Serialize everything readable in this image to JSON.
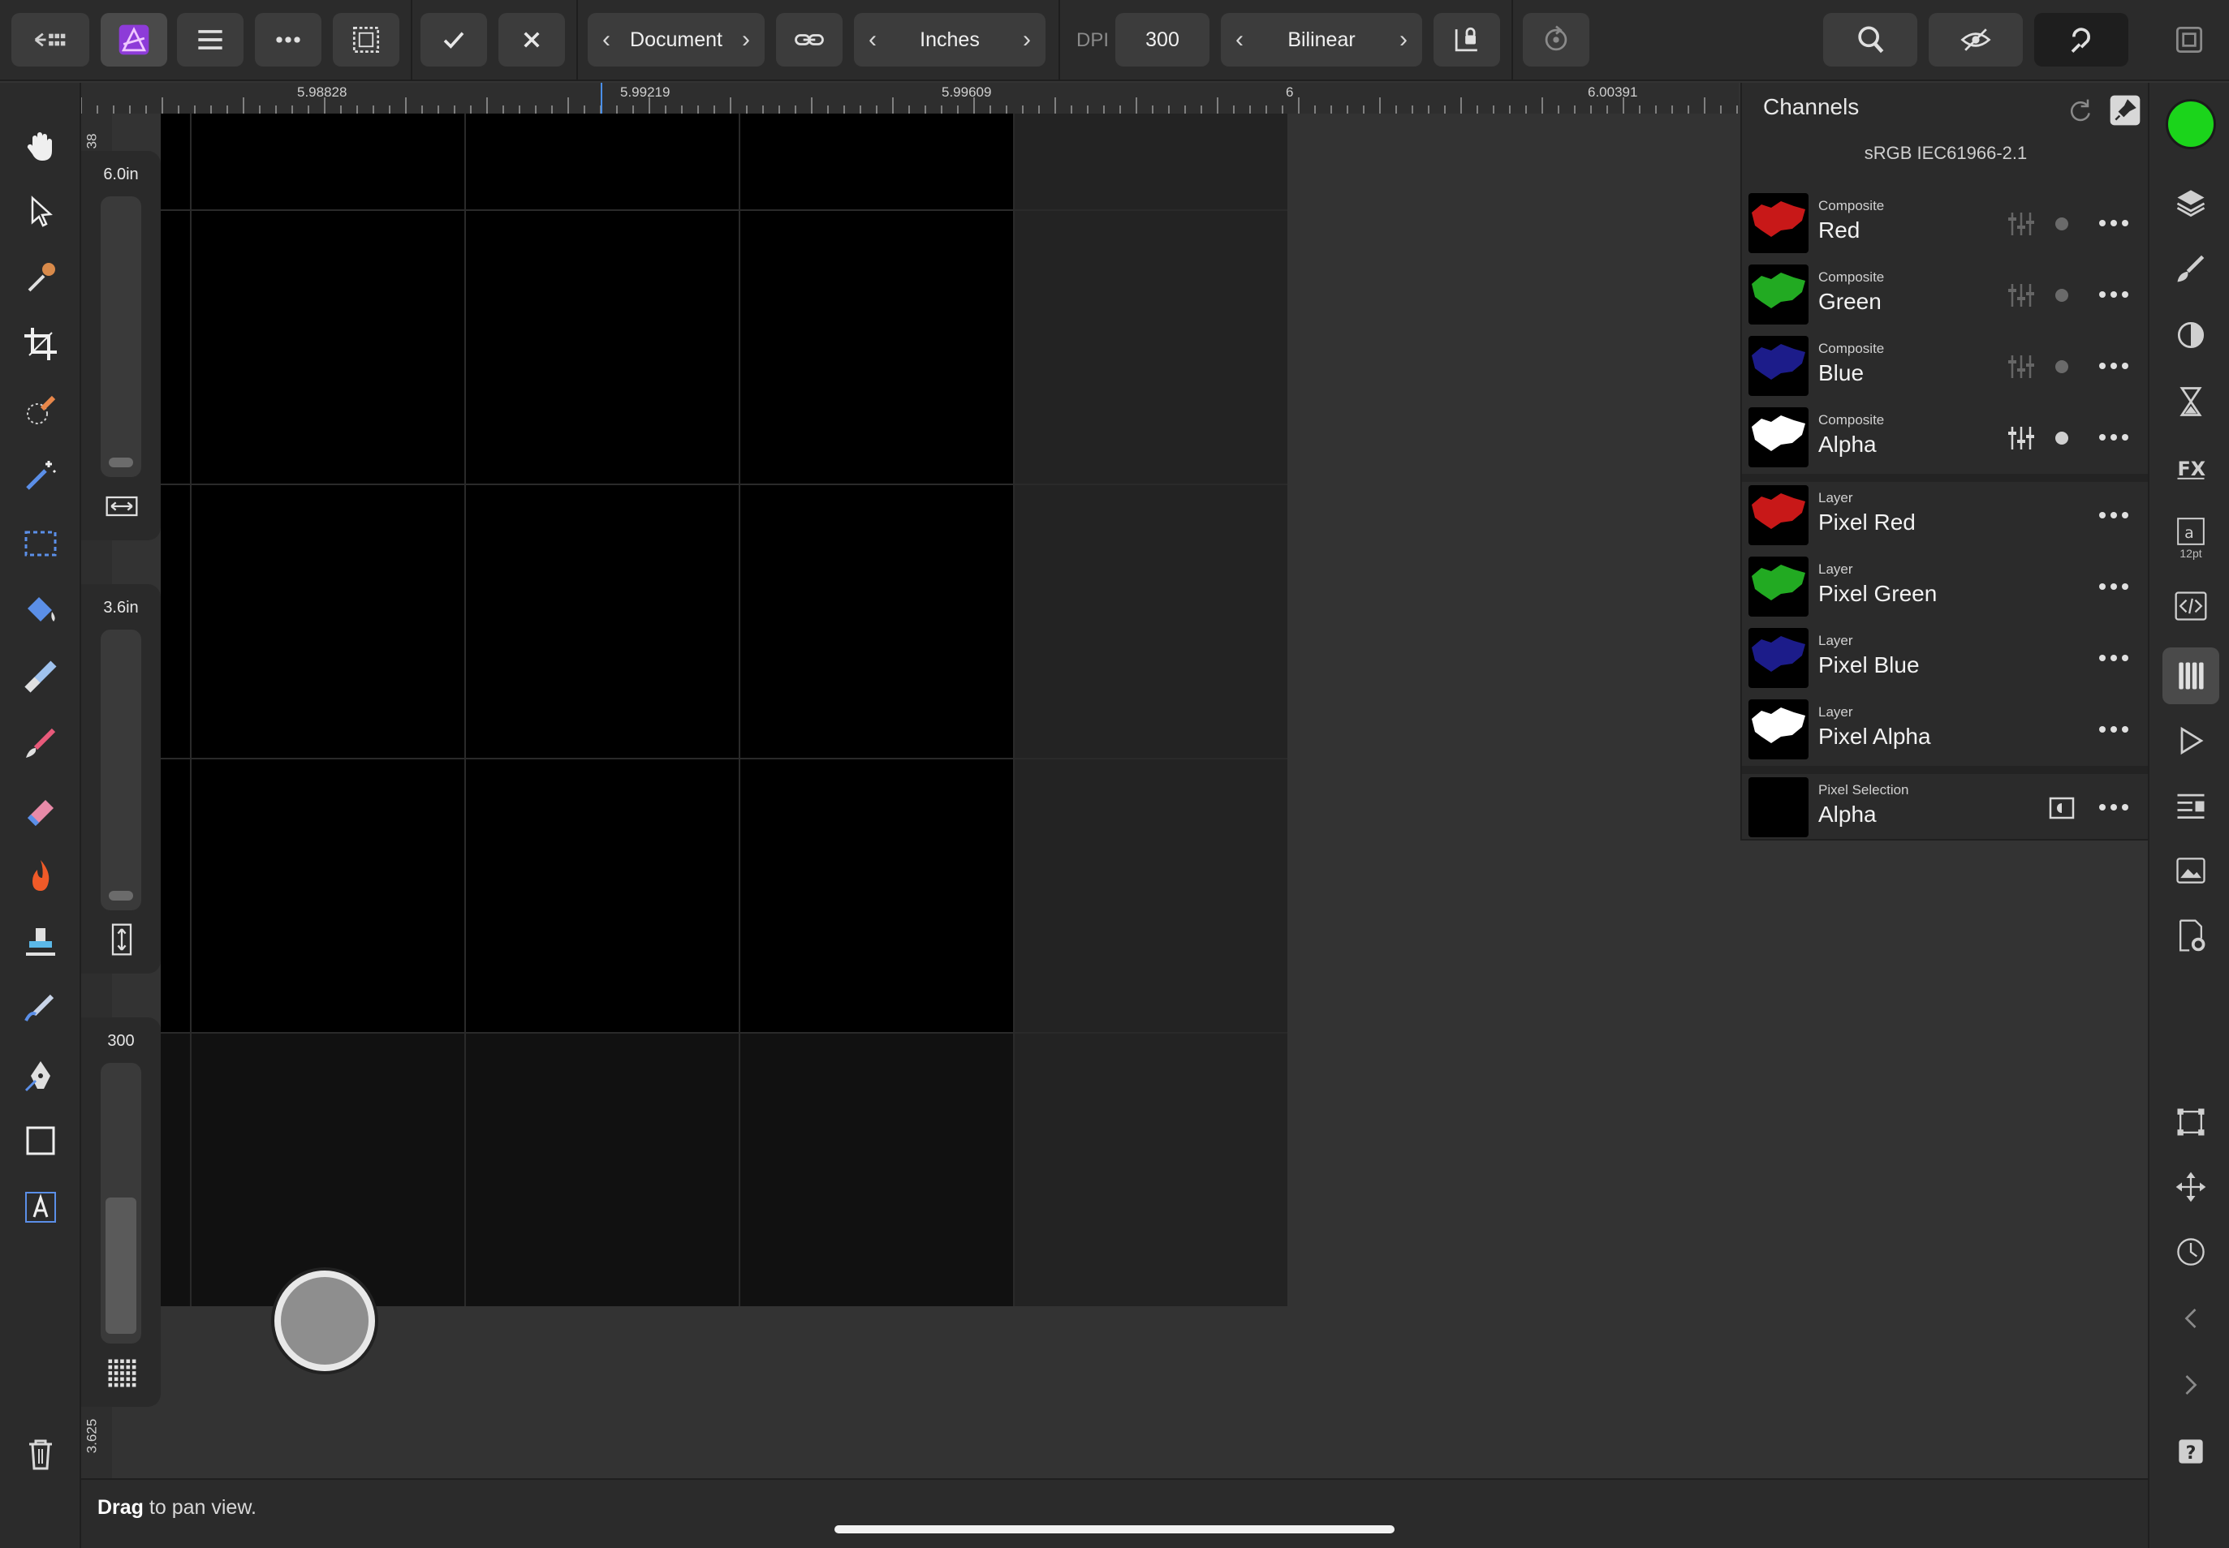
{
  "toolbar": {
    "document_label": "Document",
    "units_label": "Inches",
    "dpi_label": "DPI",
    "dpi_value": "300",
    "resample_label": "Bilinear"
  },
  "ruler": {
    "unit": "in",
    "ticks": [
      "5.98828",
      "5.99219",
      "5.99609",
      "6",
      "6.00391"
    ],
    "left_top": "38",
    "left_bottom": "3.625"
  },
  "sliders": {
    "width_value": "6.0in",
    "height_value": "3.6in",
    "dpi_value": "300"
  },
  "channels": {
    "title": "Channels",
    "profile": "sRGB IEC61966-2.1",
    "rows": [
      {
        "type": "Composite",
        "name": "Red",
        "color": "#c81818"
      },
      {
        "type": "Composite",
        "name": "Green",
        "color": "#22aa22"
      },
      {
        "type": "Composite",
        "name": "Blue",
        "color": "#1c1c8a"
      },
      {
        "type": "Composite",
        "name": "Alpha",
        "color": "#ffffff"
      },
      {
        "type": "Layer",
        "name": "Pixel Red",
        "color": "#c81818"
      },
      {
        "type": "Layer",
        "name": "Pixel Green",
        "color": "#22aa22"
      },
      {
        "type": "Layer",
        "name": "Pixel Blue",
        "color": "#1c1c8a"
      },
      {
        "type": "Layer",
        "name": "Pixel Alpha",
        "color": "#ffffff"
      },
      {
        "type": "Pixel Selection",
        "name": "Alpha",
        "color": "#000000"
      }
    ]
  },
  "studio": {
    "text_size": "12pt",
    "primary_color": "#1bd41b"
  },
  "status": {
    "bold": "Drag",
    "rest": " to pan view."
  }
}
